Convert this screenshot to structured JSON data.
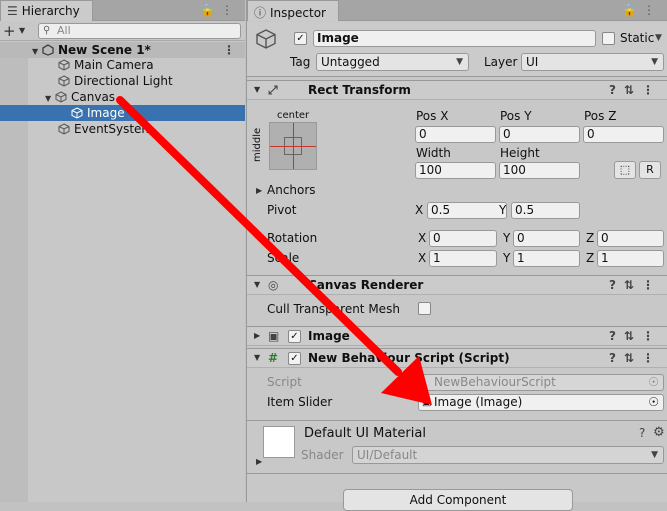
{
  "hierarchy": {
    "tab_label": "Hierarchy",
    "search_placeholder": "All",
    "items": [
      {
        "label": "New Scene 1*"
      },
      {
        "label": "Main Camera"
      },
      {
        "label": "Directional Light"
      },
      {
        "label": "Canvas"
      },
      {
        "label": "Image"
      },
      {
        "label": "EventSystem"
      }
    ]
  },
  "inspector": {
    "tab_label": "Inspector",
    "object_name": "Image",
    "static_label": "Static",
    "tag_label": "Tag",
    "tag_value": "Untagged",
    "layer_label": "Layer",
    "layer_value": "UI",
    "rect_transform": {
      "title": "Rect Transform",
      "anchor_h": "center",
      "anchor_v": "middle",
      "pos_x_label": "Pos X",
      "pos_x": "0",
      "pos_y_label": "Pos Y",
      "pos_y": "0",
      "pos_z_label": "Pos Z",
      "pos_z": "0",
      "width_label": "Width",
      "width": "100",
      "height_label": "Height",
      "height": "100",
      "r_button": "R",
      "anchors_label": "Anchors",
      "pivot_label": "Pivot",
      "pivot_x": "0.5",
      "pivot_y": "0.5",
      "rotation_label": "Rotation",
      "rotation_x": "0",
      "rotation_y": "0",
      "rotation_z": "0",
      "scale_label": "Scale",
      "scale_x": "1",
      "scale_y": "1",
      "scale_z": "1",
      "x": "X",
      "y": "Y",
      "z": "Z"
    },
    "canvas_renderer": {
      "title": "Canvas Renderer",
      "cull_label": "Cull Transparent Mesh"
    },
    "image_component": {
      "title": "Image"
    },
    "script_component": {
      "title": "New Behaviour Script (Script)",
      "script_label": "Script",
      "script_value": "NewBehaviourScript",
      "item_slider_label": "Item Slider",
      "item_slider_value": "Image (Image)"
    },
    "material": {
      "name": "Default UI Material",
      "shader_label": "Shader",
      "shader_value": "UI/Default"
    },
    "add_component": "Add Component"
  },
  "colors": {
    "selection": "#3a72b0",
    "arrow": "#ff0000"
  }
}
